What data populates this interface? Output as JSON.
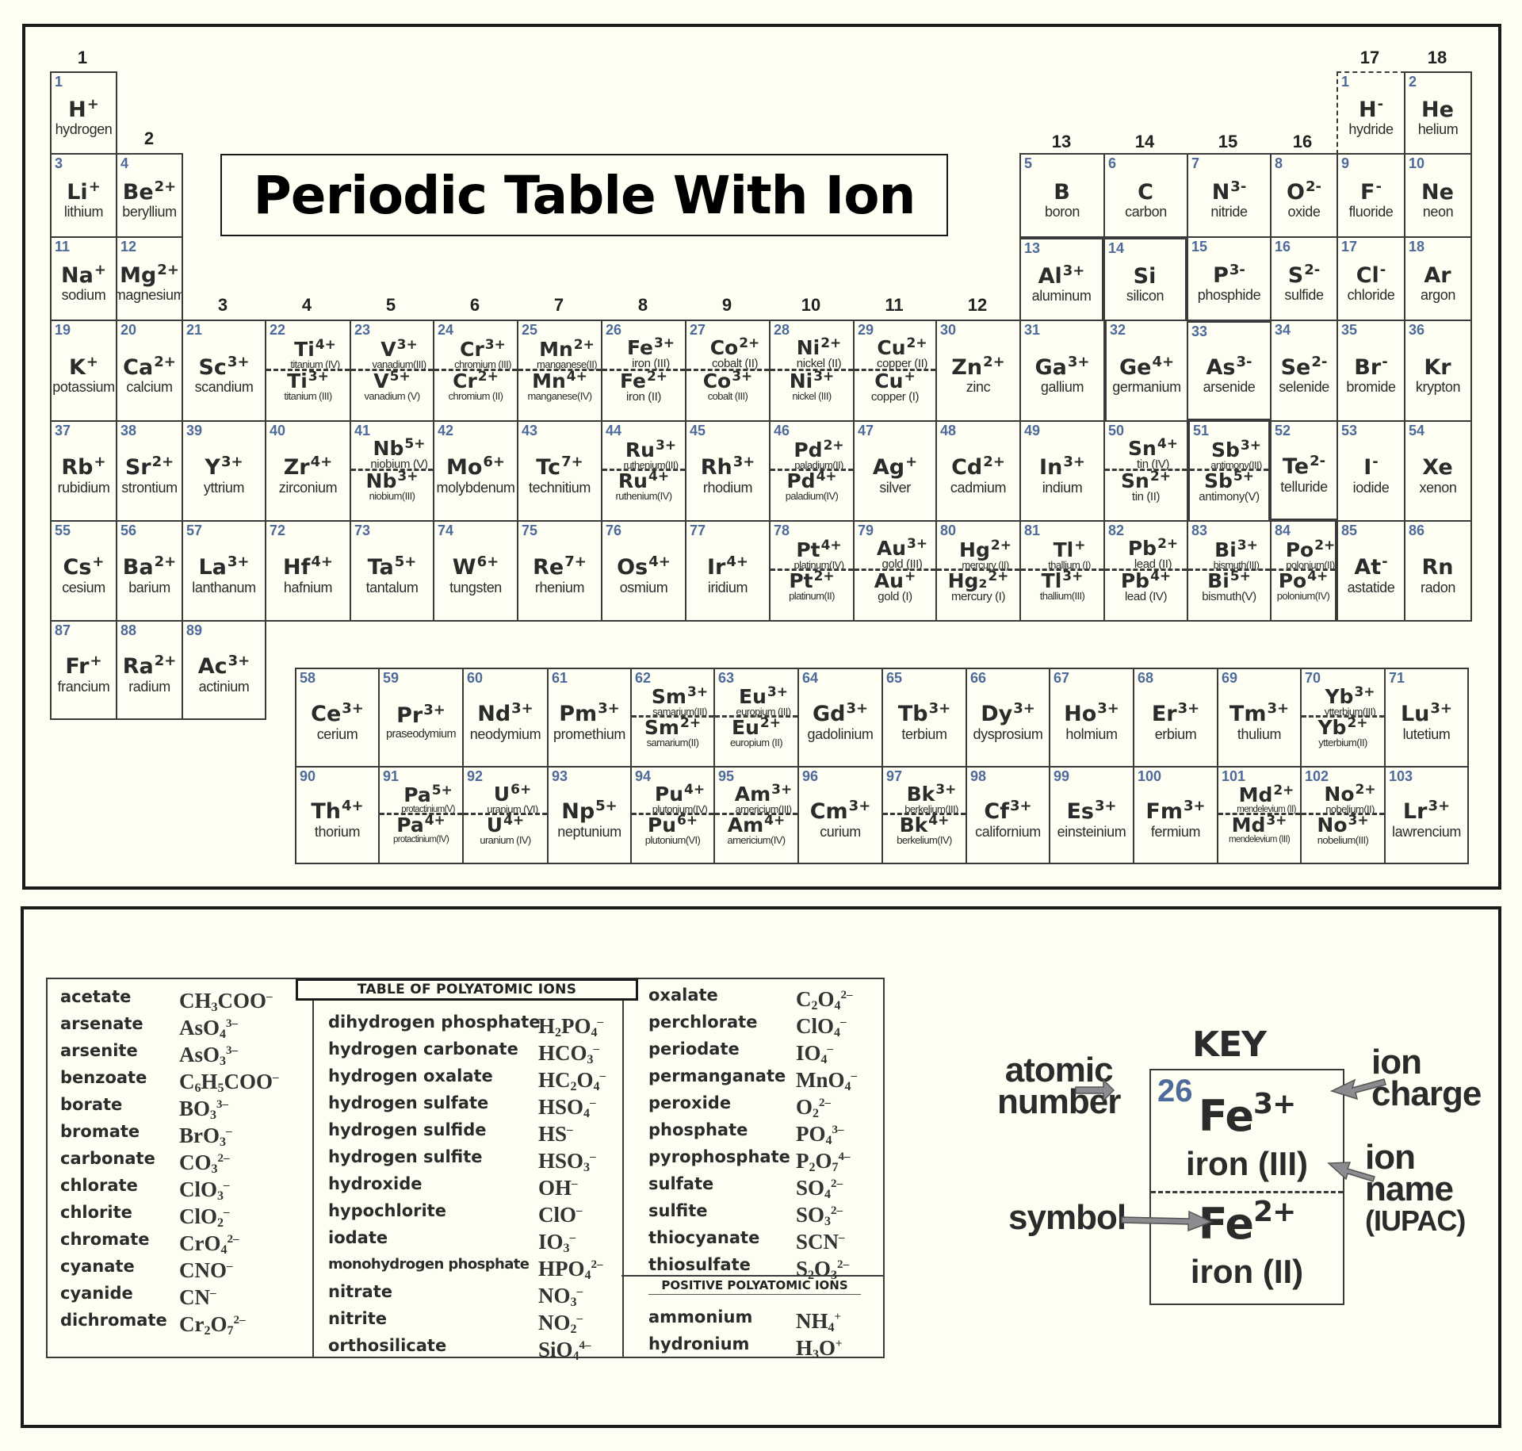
{
  "title": "Periodic Table With Ion",
  "group_labels": [
    "1",
    "2",
    "3",
    "4",
    "5",
    "6",
    "7",
    "8",
    "9",
    "10",
    "11",
    "12",
    "13",
    "14",
    "15",
    "16",
    "17",
    "18"
  ],
  "elements": [
    {
      "num": "1",
      "sym": "H",
      "charge": "+",
      "name": "hydrogen"
    },
    {
      "num": "1",
      "sym": "H",
      "charge": "-",
      "name": "hydride",
      "note": "group 17 placement, dashed"
    },
    {
      "num": "2",
      "sym": "He",
      "charge": "",
      "name": "helium"
    },
    {
      "num": "3",
      "sym": "Li",
      "charge": "+",
      "name": "lithium"
    },
    {
      "num": "4",
      "sym": "Be",
      "charge": "2+",
      "name": "beryllium"
    },
    {
      "num": "5",
      "sym": "B",
      "charge": "",
      "name": "boron"
    },
    {
      "num": "6",
      "sym": "C",
      "charge": "",
      "name": "carbon"
    },
    {
      "num": "7",
      "sym": "N",
      "charge": "3-",
      "name": "nitride"
    },
    {
      "num": "8",
      "sym": "O",
      "charge": "2-",
      "name": "oxide"
    },
    {
      "num": "9",
      "sym": "F",
      "charge": "-",
      "name": "fluoride"
    },
    {
      "num": "10",
      "sym": "Ne",
      "charge": "",
      "name": "neon"
    },
    {
      "num": "11",
      "sym": "Na",
      "charge": "+",
      "name": "sodium"
    },
    {
      "num": "12",
      "sym": "Mg",
      "charge": "2+",
      "name": "magnesium"
    },
    {
      "num": "13",
      "sym": "Al",
      "charge": "3+",
      "name": "aluminum"
    },
    {
      "num": "14",
      "sym": "Si",
      "charge": "",
      "name": "silicon"
    },
    {
      "num": "15",
      "sym": "P",
      "charge": "3-",
      "name": "phosphide"
    },
    {
      "num": "16",
      "sym": "S",
      "charge": "2-",
      "name": "sulfide"
    },
    {
      "num": "17",
      "sym": "Cl",
      "charge": "-",
      "name": "chloride"
    },
    {
      "num": "18",
      "sym": "Ar",
      "charge": "",
      "name": "argon"
    },
    {
      "num": "19",
      "sym": "K",
      "charge": "+",
      "name": "potassium"
    },
    {
      "num": "20",
      "sym": "Ca",
      "charge": "2+",
      "name": "calcium"
    },
    {
      "num": "21",
      "sym": "Sc",
      "charge": "3+",
      "name": "scandium"
    },
    {
      "num": "22",
      "sym": "Ti",
      "charge": "4+",
      "name": "titanium (IV)",
      "sym2": "Ti",
      "charge2": "3+",
      "name2": "titanium (III)"
    },
    {
      "num": "23",
      "sym": "V",
      "charge": "3+",
      "name": "vanadium(III)",
      "sym2": "V",
      "charge2": "5+",
      "name2": "vanadium (V)"
    },
    {
      "num": "24",
      "sym": "Cr",
      "charge": "3+",
      "name": "chromium (III)",
      "sym2": "Cr",
      "charge2": "2+",
      "name2": "chromium (II)"
    },
    {
      "num": "25",
      "sym": "Mn",
      "charge": "2+",
      "name": "manganese(II)",
      "sym2": "Mn",
      "charge2": "4+",
      "name2": "manganese(IV)"
    },
    {
      "num": "26",
      "sym": "Fe",
      "charge": "3+",
      "name": "iron (III)",
      "sym2": "Fe",
      "charge2": "2+",
      "name2": "iron (II)"
    },
    {
      "num": "27",
      "sym": "Co",
      "charge": "2+",
      "name": "cobalt (II)",
      "sym2": "Co",
      "charge2": "3+",
      "name2": "cobalt (III)"
    },
    {
      "num": "28",
      "sym": "Ni",
      "charge": "2+",
      "name": "nickel (II)",
      "sym2": "Ni",
      "charge2": "3+",
      "name2": "nickel (III)"
    },
    {
      "num": "29",
      "sym": "Cu",
      "charge": "2+",
      "name": "copper (II)",
      "sym2": "Cu",
      "charge2": "+",
      "name2": "copper (I)"
    },
    {
      "num": "30",
      "sym": "Zn",
      "charge": "2+",
      "name": "zinc"
    },
    {
      "num": "31",
      "sym": "Ga",
      "charge": "3+",
      "name": "gallium"
    },
    {
      "num": "32",
      "sym": "Ge",
      "charge": "4+",
      "name": "germanium"
    },
    {
      "num": "33",
      "sym": "As",
      "charge": "3-",
      "name": "arsenide"
    },
    {
      "num": "34",
      "sym": "Se",
      "charge": "2-",
      "name": "selenide"
    },
    {
      "num": "35",
      "sym": "Br",
      "charge": "-",
      "name": "bromide"
    },
    {
      "num": "36",
      "sym": "Kr",
      "charge": "",
      "name": "krypton"
    },
    {
      "num": "37",
      "sym": "Rb",
      "charge": "+",
      "name": "rubidium"
    },
    {
      "num": "38",
      "sym": "Sr",
      "charge": "2+",
      "name": "strontium"
    },
    {
      "num": "39",
      "sym": "Y",
      "charge": "3+",
      "name": "yttrium"
    },
    {
      "num": "40",
      "sym": "Zr",
      "charge": "4+",
      "name": "zirconium"
    },
    {
      "num": "41",
      "sym": "Nb",
      "charge": "5+",
      "name": "niobium (V)",
      "sym2": "Nb",
      "charge2": "3+",
      "name2": "niobium(III)"
    },
    {
      "num": "42",
      "sym": "Mo",
      "charge": "6+",
      "name": "molybdenum"
    },
    {
      "num": "43",
      "sym": "Tc",
      "charge": "7+",
      "name": "technitium"
    },
    {
      "num": "44",
      "sym": "Ru",
      "charge": "3+",
      "name": "ruthenium(III)",
      "sym2": "Ru",
      "charge2": "4+",
      "name2": "ruthenium(IV)"
    },
    {
      "num": "45",
      "sym": "Rh",
      "charge": "3+",
      "name": "rhodium"
    },
    {
      "num": "46",
      "sym": "Pd",
      "charge": "2+",
      "name": "paladium(II)",
      "sym2": "Pd",
      "charge2": "4+",
      "name2": "paladium(IV)"
    },
    {
      "num": "47",
      "sym": "Ag",
      "charge": "+",
      "name": "silver"
    },
    {
      "num": "48",
      "sym": "Cd",
      "charge": "2+",
      "name": "cadmium"
    },
    {
      "num": "49",
      "sym": "In",
      "charge": "3+",
      "name": "indium"
    },
    {
      "num": "50",
      "sym": "Sn",
      "charge": "4+",
      "name": "tin (IV)",
      "sym2": "Sn",
      "charge2": "2+",
      "name2": "tin (II)"
    },
    {
      "num": "51",
      "sym": "Sb",
      "charge": "3+",
      "name": "antimony(III)",
      "sym2": "Sb",
      "charge2": "5+",
      "name2": "antimony(V)"
    },
    {
      "num": "52",
      "sym": "Te",
      "charge": "2-",
      "name": "telluride"
    },
    {
      "num": "53",
      "sym": "I",
      "charge": "-",
      "name": "iodide"
    },
    {
      "num": "54",
      "sym": "Xe",
      "charge": "",
      "name": "xenon"
    },
    {
      "num": "55",
      "sym": "Cs",
      "charge": "+",
      "name": "cesium"
    },
    {
      "num": "56",
      "sym": "Ba",
      "charge": "2+",
      "name": "barium"
    },
    {
      "num": "57",
      "sym": "La",
      "charge": "3+",
      "name": "lanthanum"
    },
    {
      "num": "72",
      "sym": "Hf",
      "charge": "4+",
      "name": "hafnium"
    },
    {
      "num": "73",
      "sym": "Ta",
      "charge": "5+",
      "name": "tantalum"
    },
    {
      "num": "74",
      "sym": "W",
      "charge": "6+",
      "name": "tungsten"
    },
    {
      "num": "75",
      "sym": "Re",
      "charge": "7+",
      "name": "rhenium"
    },
    {
      "num": "76",
      "sym": "Os",
      "charge": "4+",
      "name": "osmium"
    },
    {
      "num": "77",
      "sym": "Ir",
      "charge": "4+",
      "name": "iridium"
    },
    {
      "num": "78",
      "sym": "Pt",
      "charge": "4+",
      "name": "platinum(IV)",
      "sym2": "Pt",
      "charge2": "2+",
      "name2": "platinum(II)"
    },
    {
      "num": "79",
      "sym": "Au",
      "charge": "3+",
      "name": "gold (III)",
      "sym2": "Au",
      "charge2": "+",
      "name2": "gold (I)"
    },
    {
      "num": "80",
      "sym": "Hg",
      "charge": "2+",
      "name": "mercury (II)",
      "sym2": "Hg₂",
      "charge2": "2+",
      "name2": "mercury (I)"
    },
    {
      "num": "81",
      "sym": "Tl",
      "charge": "+",
      "name": "thallium (I)",
      "sym2": "Tl",
      "charge2": "3+",
      "name2": "thallium(III)"
    },
    {
      "num": "82",
      "sym": "Pb",
      "charge": "2+",
      "name": "lead (II)",
      "sym2": "Pb",
      "charge2": "4+",
      "name2": "lead (IV)"
    },
    {
      "num": "83",
      "sym": "Bi",
      "charge": "3+",
      "name": "bismuth(III)",
      "sym2": "Bi",
      "charge2": "5+",
      "name2": "bismuth(V)"
    },
    {
      "num": "84",
      "sym": "Po",
      "charge": "2+",
      "name": "polonium(II)",
      "sym2": "Po",
      "charge2": "4+",
      "name2": "polonium(IV)"
    },
    {
      "num": "85",
      "sym": "At",
      "charge": "-",
      "name": "astatide"
    },
    {
      "num": "86",
      "sym": "Rn",
      "charge": "",
      "name": "radon"
    },
    {
      "num": "87",
      "sym": "Fr",
      "charge": "+",
      "name": "francium"
    },
    {
      "num": "88",
      "sym": "Ra",
      "charge": "2+",
      "name": "radium"
    },
    {
      "num": "89",
      "sym": "Ac",
      "charge": "3+",
      "name": "actinium"
    },
    {
      "num": "58",
      "sym": "Ce",
      "charge": "3+",
      "name": "cerium"
    },
    {
      "num": "59",
      "sym": "Pr",
      "charge": "3+",
      "name": "praseodymium"
    },
    {
      "num": "60",
      "sym": "Nd",
      "charge": "3+",
      "name": "neodymium"
    },
    {
      "num": "61",
      "sym": "Pm",
      "charge": "3+",
      "name": "promethium"
    },
    {
      "num": "62",
      "sym": "Sm",
      "charge": "3+",
      "name": "samarium(III)",
      "sym2": "Sm",
      "charge2": "2+",
      "name2": "samarium(II)"
    },
    {
      "num": "63",
      "sym": "Eu",
      "charge": "3+",
      "name": "europium (III)",
      "sym2": "Eu",
      "charge2": "2+",
      "name2": "europium (II)"
    },
    {
      "num": "64",
      "sym": "Gd",
      "charge": "3+",
      "name": "gadolinium"
    },
    {
      "num": "65",
      "sym": "Tb",
      "charge": "3+",
      "name": "terbium"
    },
    {
      "num": "66",
      "sym": "Dy",
      "charge": "3+",
      "name": "dysprosium"
    },
    {
      "num": "67",
      "sym": "Ho",
      "charge": "3+",
      "name": "holmium"
    },
    {
      "num": "68",
      "sym": "Er",
      "charge": "3+",
      "name": "erbium"
    },
    {
      "num": "69",
      "sym": "Tm",
      "charge": "3+",
      "name": "thulium"
    },
    {
      "num": "70",
      "sym": "Yb",
      "charge": "3+",
      "name": "ytterbium(III)",
      "sym2": "Yb",
      "charge2": "2+",
      "name2": "ytterbium(II)"
    },
    {
      "num": "71",
      "sym": "Lu",
      "charge": "3+",
      "name": "lutetium"
    },
    {
      "num": "90",
      "sym": "Th",
      "charge": "4+",
      "name": "thorium"
    },
    {
      "num": "91",
      "sym": "Pa",
      "charge": "5+",
      "name": "protactinium(V)",
      "sym2": "Pa",
      "charge2": "4+",
      "name2": "protactinium(IV)"
    },
    {
      "num": "92",
      "sym": "U",
      "charge": "6+",
      "name": "uranium (VI)",
      "sym2": "U",
      "charge2": "4+",
      "name2": "uranium (IV)"
    },
    {
      "num": "93",
      "sym": "Np",
      "charge": "5+",
      "name": "neptunium"
    },
    {
      "num": "94",
      "sym": "Pu",
      "charge": "4+",
      "name": "plutonium(IV)",
      "sym2": "Pu",
      "charge2": "6+",
      "name2": "plutonium(VI)"
    },
    {
      "num": "95",
      "sym": "Am",
      "charge": "3+",
      "name": "americium(III)",
      "sym2": "Am",
      "charge2": "4+",
      "name2": "americium(IV)"
    },
    {
      "num": "96",
      "sym": "Cm",
      "charge": "3+",
      "name": "curium"
    },
    {
      "num": "97",
      "sym": "Bk",
      "charge": "3+",
      "name": "berkelium(III)",
      "sym2": "Bk",
      "charge2": "4+",
      "name2": "berkelium(IV)"
    },
    {
      "num": "98",
      "sym": "Cf",
      "charge": "3+",
      "name": "californium"
    },
    {
      "num": "99",
      "sym": "Es",
      "charge": "3+",
      "name": "einsteinium"
    },
    {
      "num": "100",
      "sym": "Fm",
      "charge": "3+",
      "name": "fermium"
    },
    {
      "num": "101",
      "sym": "Md",
      "charge": "2+",
      "name": "mendelevium (II)",
      "sym2": "Md",
      "charge2": "3+",
      "name2": "mendelevium (III)"
    },
    {
      "num": "102",
      "sym": "No",
      "charge": "2+",
      "name": "nobelium(II)",
      "sym2": "No",
      "charge2": "3+",
      "name2": "nobelium(III)"
    },
    {
      "num": "103",
      "sym": "Lr",
      "charge": "3+",
      "name": "lawrencium"
    }
  ],
  "polyatomic": {
    "title": "TABLE OF POLYATOMIC IONS",
    "columns": [
      [
        {
          "name": "acetate",
          "formula": "CH<sub>3</sub>COO<sup>–</sup>"
        },
        {
          "name": "arsenate",
          "formula": "AsO<sub>4</sub><sup>3–</sup>"
        },
        {
          "name": "arsenite",
          "formula": "AsO<sub>3</sub><sup>3–</sup>"
        },
        {
          "name": "benzoate",
          "formula": "C<sub>6</sub>H<sub>5</sub>COO<sup>–</sup>"
        },
        {
          "name": "borate",
          "formula": "BO<sub>3</sub><sup>3–</sup>"
        },
        {
          "name": "bromate",
          "formula": "BrO<sub>3</sub><sup>–</sup>"
        },
        {
          "name": "carbonate",
          "formula": "CO<sub>3</sub><sup>2–</sup>"
        },
        {
          "name": "chlorate",
          "formula": "ClO<sub>3</sub><sup>–</sup>"
        },
        {
          "name": "chlorite",
          "formula": "ClO<sub>2</sub><sup>–</sup>"
        },
        {
          "name": "chromate",
          "formula": "CrO<sub>4</sub><sup>2–</sup>"
        },
        {
          "name": "cyanate",
          "formula": "CNO<sup>–</sup>"
        },
        {
          "name": "cyanide",
          "formula": "CN<sup>–</sup>"
        },
        {
          "name": "dichromate",
          "formula": "Cr<sub>2</sub>O<sub>7</sub><sup>2–</sup>"
        }
      ],
      [
        {
          "name": "dihydrogen phosphate",
          "formula": "H<sub>2</sub>PO<sub>4</sub><sup>–</sup>"
        },
        {
          "name": "hydrogen carbonate",
          "formula": "HCO<sub>3</sub><sup>–</sup>"
        },
        {
          "name": "hydrogen oxalate",
          "formula": "HC<sub>2</sub>O<sub>4</sub><sup>–</sup>"
        },
        {
          "name": "hydrogen sulfate",
          "formula": "HSO<sub>4</sub><sup>–</sup>"
        },
        {
          "name": "hydrogen sulfide",
          "formula": "HS<sup>–</sup>"
        },
        {
          "name": "hydrogen sulfite",
          "formula": "HSO<sub>3</sub><sup>–</sup>"
        },
        {
          "name": "hydroxide",
          "formula": "OH<sup>–</sup>"
        },
        {
          "name": "hypochlorite",
          "formula": "ClO<sup>–</sup>"
        },
        {
          "name": "iodate",
          "formula": "IO<sub>3</sub><sup>–</sup>"
        },
        {
          "name": "monohydrogen phosphate",
          "formula": "HPO<sub>4</sub><sup>2–</sup>",
          "narrow": true
        },
        {
          "name": "nitrate",
          "formula": "NO<sub>3</sub><sup>–</sup>"
        },
        {
          "name": "nitrite",
          "formula": "NO<sub>2</sub><sup>–</sup>"
        },
        {
          "name": "orthosilicate",
          "formula": "SiO<sub>4</sub><sup>4–</sup>"
        }
      ],
      [
        {
          "name": "oxalate",
          "formula": "C<sub>2</sub>O<sub>4</sub><sup>2–</sup>"
        },
        {
          "name": "perchlorate",
          "formula": "ClO<sub>4</sub><sup>–</sup>"
        },
        {
          "name": "periodate",
          "formula": "IO<sub>4</sub><sup>–</sup>"
        },
        {
          "name": "permanganate",
          "formula": "MnO<sub>4</sub><sup>–</sup>"
        },
        {
          "name": "peroxide",
          "formula": "O<sub>2</sub><sup>2–</sup>"
        },
        {
          "name": "phosphate",
          "formula": "PO<sub>4</sub><sup>3–</sup>"
        },
        {
          "name": "pyrophosphate",
          "formula": "P<sub>2</sub>O<sub>7</sub><sup>4–</sup>"
        },
        {
          "name": "sulfate",
          "formula": "SO<sub>4</sub><sup>2–</sup>"
        },
        {
          "name": "sulfite",
          "formula": "SO<sub>3</sub><sup>2–</sup>"
        },
        {
          "name": "thiocyanate",
          "formula": "SCN<sup>–</sup>"
        },
        {
          "name": "thiosulfate",
          "formula": "S<sub>2</sub>O<sub>3</sub><sup>2–</sup>"
        }
      ]
    ],
    "positive_title": "POSITIVE POLYATOMIC IONS",
    "positive": [
      {
        "name": "ammonium",
        "formula": "NH<sub>4</sub><sup>+</sup>"
      },
      {
        "name": "hydronium",
        "formula": "H<sub>3</sub>O<sup>+</sup>"
      }
    ]
  },
  "key": {
    "title": "KEY",
    "num": "26",
    "sym": "Fe",
    "charge": "3+",
    "name": "iron (III)",
    "sym2": "Fe",
    "charge2": "2+",
    "name2": "iron (II)",
    "labels": {
      "atomic_number": [
        "atomic",
        "number"
      ],
      "ion_charge": [
        "ion",
        "charge"
      ],
      "ion_name": [
        "ion",
        "name",
        "(IUPAC)"
      ],
      "symbol": "symbol"
    }
  }
}
